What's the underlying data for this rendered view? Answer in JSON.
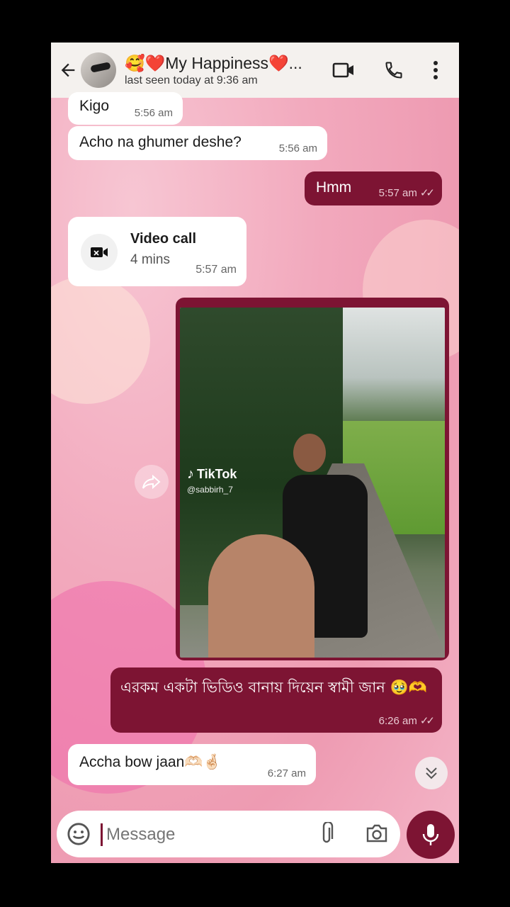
{
  "header": {
    "title": "🥰❤️My Happiness❤️...",
    "subtitle": "last seen today at 9:36 am"
  },
  "messages": [
    {
      "dir": "in",
      "text": "Kigo",
      "time": "5:56 am"
    },
    {
      "dir": "in",
      "text": "Acho na ghumer deshe?",
      "time": "5:56 am"
    },
    {
      "dir": "out",
      "text": "Hmm",
      "time": "5:57 am",
      "ticks": "✓✓"
    },
    {
      "dir": "in",
      "type": "call",
      "title": "Video call",
      "duration": "4 mins",
      "time": "5:57 am"
    },
    {
      "dir": "out",
      "type": "video",
      "brand": "TikTok",
      "handle": "@sabbirh_7"
    },
    {
      "dir": "out",
      "text": "এরকম একটা ভিডিও বানায় দিয়েন স্বামী জান 🥹🫶",
      "time": "6:26 am",
      "ticks": "✓✓"
    },
    {
      "dir": "in",
      "text": "Accha bow jaan🫶🏻🤞🏻",
      "time": "6:27 am"
    }
  ],
  "composer": {
    "placeholder": "Message"
  },
  "colors": {
    "accent": "#7d1433",
    "header_bg": "#f4f1ee"
  },
  "icons": [
    "back-arrow-icon",
    "video-camera-icon",
    "phone-icon",
    "more-vert-icon",
    "video-call-icon",
    "share-icon",
    "chevron-double-down-icon",
    "emoji-icon",
    "attach-icon",
    "camera-icon",
    "mic-icon",
    "tiktok-icon"
  ]
}
